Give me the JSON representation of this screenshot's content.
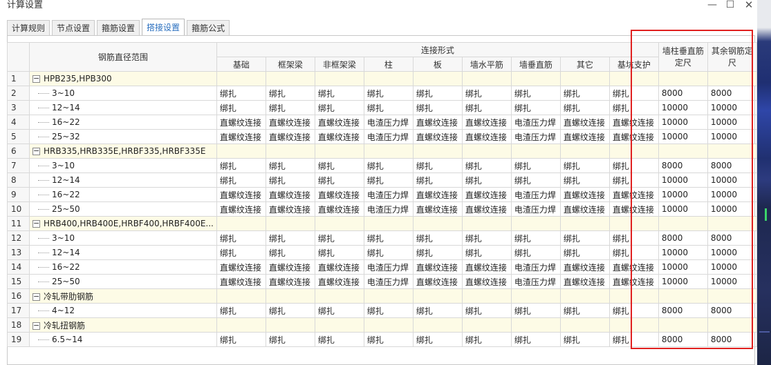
{
  "window": {
    "title": "计算设置"
  },
  "tabs": [
    {
      "label": "计算规则"
    },
    {
      "label": "节点设置"
    },
    {
      "label": "箍筋设置"
    },
    {
      "label": "搭接设置"
    },
    {
      "label": "箍筋公式"
    }
  ],
  "table": {
    "range_header": "钢筋直径范围",
    "connection_group_header": "连接形式",
    "columns": [
      "基础",
      "框架梁",
      "非框架梁",
      "柱",
      "板",
      "墙水平筋",
      "墙垂直筋",
      "其它",
      "基坑支护"
    ],
    "len_header_1": "墙柱垂直筋定尺",
    "len_header_2": "其余钢筋定尺",
    "rows": [
      {
        "no": "1",
        "group": true,
        "label": "HPB235,HPB300"
      },
      {
        "no": "2",
        "label": "3~10",
        "c": [
          "绑扎",
          "绑扎",
          "绑扎",
          "绑扎",
          "绑扎",
          "绑扎",
          "绑扎",
          "绑扎",
          "绑扎"
        ],
        "l1": "8000",
        "l2": "8000"
      },
      {
        "no": "3",
        "label": "12~14",
        "c": [
          "绑扎",
          "绑扎",
          "绑扎",
          "绑扎",
          "绑扎",
          "绑扎",
          "绑扎",
          "绑扎",
          "绑扎"
        ],
        "l1": "10000",
        "l2": "10000"
      },
      {
        "no": "4",
        "label": "16~22",
        "c": [
          "直螺纹连接",
          "直螺纹连接",
          "直螺纹连接",
          "电渣压力焊",
          "直螺纹连接",
          "直螺纹连接",
          "电渣压力焊",
          "直螺纹连接",
          "直螺纹连接"
        ],
        "l1": "10000",
        "l2": "10000"
      },
      {
        "no": "5",
        "label": "25~32",
        "c": [
          "直螺纹连接",
          "直螺纹连接",
          "直螺纹连接",
          "电渣压力焊",
          "直螺纹连接",
          "直螺纹连接",
          "电渣压力焊",
          "直螺纹连接",
          "直螺纹连接"
        ],
        "l1": "10000",
        "l2": "10000"
      },
      {
        "no": "6",
        "group": true,
        "label": "HRB335,HRB335E,HRBF335,HRBF335E"
      },
      {
        "no": "7",
        "label": "3~10",
        "c": [
          "绑扎",
          "绑扎",
          "绑扎",
          "绑扎",
          "绑扎",
          "绑扎",
          "绑扎",
          "绑扎",
          "绑扎"
        ],
        "l1": "8000",
        "l2": "8000"
      },
      {
        "no": "8",
        "label": "12~14",
        "c": [
          "绑扎",
          "绑扎",
          "绑扎",
          "绑扎",
          "绑扎",
          "绑扎",
          "绑扎",
          "绑扎",
          "绑扎"
        ],
        "l1": "10000",
        "l2": "10000"
      },
      {
        "no": "9",
        "label": "16~22",
        "c": [
          "直螺纹连接",
          "直螺纹连接",
          "直螺纹连接",
          "电渣压力焊",
          "直螺纹连接",
          "直螺纹连接",
          "电渣压力焊",
          "直螺纹连接",
          "直螺纹连接"
        ],
        "l1": "10000",
        "l2": "10000"
      },
      {
        "no": "10",
        "label": "25~50",
        "c": [
          "直螺纹连接",
          "直螺纹连接",
          "直螺纹连接",
          "电渣压力焊",
          "直螺纹连接",
          "直螺纹连接",
          "电渣压力焊",
          "直螺纹连接",
          "直螺纹连接"
        ],
        "l1": "10000",
        "l2": "10000"
      },
      {
        "no": "11",
        "group": true,
        "label": "HRB400,HRB400E,HRBF400,HRBF400E..."
      },
      {
        "no": "12",
        "label": "3~10",
        "c": [
          "绑扎",
          "绑扎",
          "绑扎",
          "绑扎",
          "绑扎",
          "绑扎",
          "绑扎",
          "绑扎",
          "绑扎"
        ],
        "l1": "8000",
        "l2": "8000"
      },
      {
        "no": "13",
        "label": "12~14",
        "c": [
          "绑扎",
          "绑扎",
          "绑扎",
          "绑扎",
          "绑扎",
          "绑扎",
          "绑扎",
          "绑扎",
          "绑扎"
        ],
        "l1": "10000",
        "l2": "10000"
      },
      {
        "no": "14",
        "label": "16~22",
        "c": [
          "直螺纹连接",
          "直螺纹连接",
          "直螺纹连接",
          "电渣压力焊",
          "直螺纹连接",
          "直螺纹连接",
          "电渣压力焊",
          "直螺纹连接",
          "直螺纹连接"
        ],
        "l1": "10000",
        "l2": "10000"
      },
      {
        "no": "15",
        "label": "25~50",
        "c": [
          "直螺纹连接",
          "直螺纹连接",
          "直螺纹连接",
          "电渣压力焊",
          "直螺纹连接",
          "直螺纹连接",
          "电渣压力焊",
          "直螺纹连接",
          "直螺纹连接"
        ],
        "l1": "10000",
        "l2": "10000"
      },
      {
        "no": "16",
        "group": true,
        "label": "冷轧带肋钢筋"
      },
      {
        "no": "17",
        "label": "4~12",
        "c": [
          "绑扎",
          "绑扎",
          "绑扎",
          "绑扎",
          "绑扎",
          "绑扎",
          "绑扎",
          "绑扎",
          "绑扎"
        ],
        "l1": "8000",
        "l2": "8000"
      },
      {
        "no": "18",
        "group": true,
        "label": "冷轧扭钢筋"
      },
      {
        "no": "19",
        "label": "6.5~14",
        "c": [
          "绑扎",
          "绑扎",
          "绑扎",
          "绑扎",
          "绑扎",
          "绑扎",
          "绑扎",
          "绑扎",
          "绑扎"
        ],
        "l1": "8000",
        "l2": "8000"
      }
    ]
  },
  "colors": {
    "highlight": "#e0201f",
    "group_row": "#fdfbe6",
    "active_tab": "#2a6fbf"
  }
}
